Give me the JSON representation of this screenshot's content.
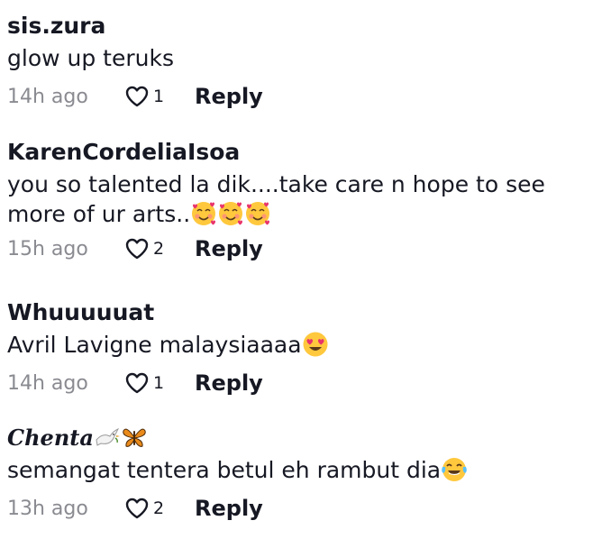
{
  "comments": [
    {
      "username": "sis.zura",
      "text": "glow up teruks",
      "emojis": [],
      "time": "14h ago",
      "likes": "1",
      "reply_label": "Reply"
    },
    {
      "username": "KarenCordeliaIsoa",
      "text_line1": "you so talented la dik....take care n hope to see",
      "text_line2": "more of ur arts..",
      "emojis": [
        "smiling-face-with-hearts",
        "smiling-face-with-hearts",
        "smiling-face-with-hearts"
      ],
      "time": "15h ago",
      "likes": "2",
      "reply_label": "Reply"
    },
    {
      "username": "Whuuuuuat",
      "text": "Avril Lavigne malaysiaaaa",
      "emojis": [
        "heart-eyes"
      ],
      "time": "14h ago",
      "likes": "1",
      "reply_label": "Reply"
    },
    {
      "username": "Chenta",
      "username_emojis": [
        "dove",
        "butterfly"
      ],
      "text": "semangat tentera betul eh rambut dia",
      "emojis": [
        "face-with-tears-of-joy"
      ],
      "time": "13h ago",
      "likes": "2",
      "reply_label": "Reply"
    }
  ]
}
